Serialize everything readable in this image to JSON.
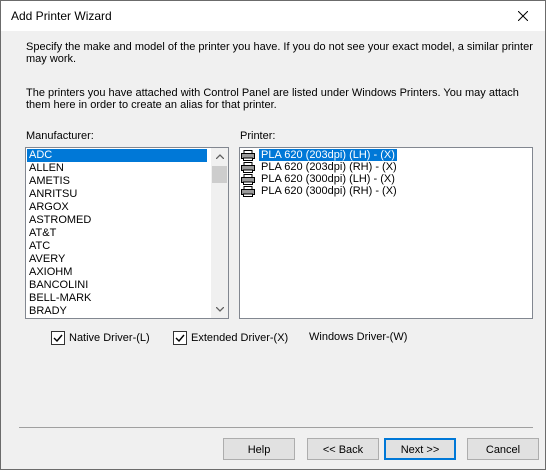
{
  "window": {
    "title": "Add Printer Wizard",
    "close_icon": "close-icon"
  },
  "instructions": {
    "p1": "Specify the make and model of the printer you have.  If you do not see your exact model, a similar printer may work.",
    "p2": "The printers you have attached with Control Panel are listed under Windows Printers.  You may attach them here in order to create an alias for that printer."
  },
  "manufacturer": {
    "label": "Manufacturer:",
    "items": [
      "ADC",
      "ALLEN",
      "AMETIS",
      "ANRITSU",
      "ARGOX",
      "ASTROMED",
      "AT&T",
      "ATC",
      "AVERY",
      "AXIOHM",
      "BANCOLINI",
      "BELL-MARK",
      "BRADY"
    ],
    "selected": "ADC"
  },
  "printer": {
    "label": "Printer:",
    "items": [
      "PLA 620 (203dpi) (LH) - (X)",
      "PLA 620 (203dpi) (RH) - (X)",
      "PLA 620 (300dpi) (LH) - (X)",
      "PLA 620 (300dpi) (RH) - (X)"
    ],
    "selected": "PLA 620 (203dpi) (LH) - (X)",
    "icon": "printer-icon"
  },
  "options": {
    "native": {
      "label": "Native Driver-(L)",
      "checked": true
    },
    "extended": {
      "label": "Extended Driver-(X)",
      "checked": true
    },
    "windows": {
      "label": "Windows Driver-(W)"
    }
  },
  "buttons": {
    "help": "Help",
    "back": "<< Back",
    "next": "Next >>",
    "cancel": "Cancel"
  },
  "colors": {
    "selection": "#0078d7",
    "dialog_bg": "#f0f0f0"
  }
}
